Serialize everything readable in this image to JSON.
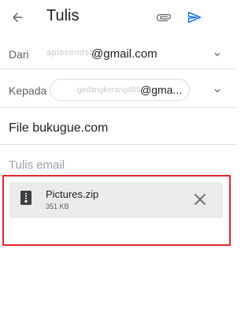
{
  "appbar": {
    "title": "Tulis",
    "back_icon": "arrow-left-icon",
    "attach_icon": "paperclip-icon",
    "send_icon": "send-icon",
    "send_color": "#1a73e8"
  },
  "from": {
    "label": "Dari",
    "redacted_prefix": "aplosendsan",
    "value_suffix": "@gmail.com"
  },
  "to": {
    "label": "Kepada",
    "chip_redacted": "gedangkerang455",
    "chip_suffix": "@gma..."
  },
  "subject": "File bukugue.com",
  "body_placeholder": "Tulis email",
  "attachment": {
    "name": "Pictures.zip",
    "size": "351 KB",
    "icon": "zip-file-icon",
    "remove_icon": "close-icon"
  },
  "highlight_color": "#e5262b"
}
